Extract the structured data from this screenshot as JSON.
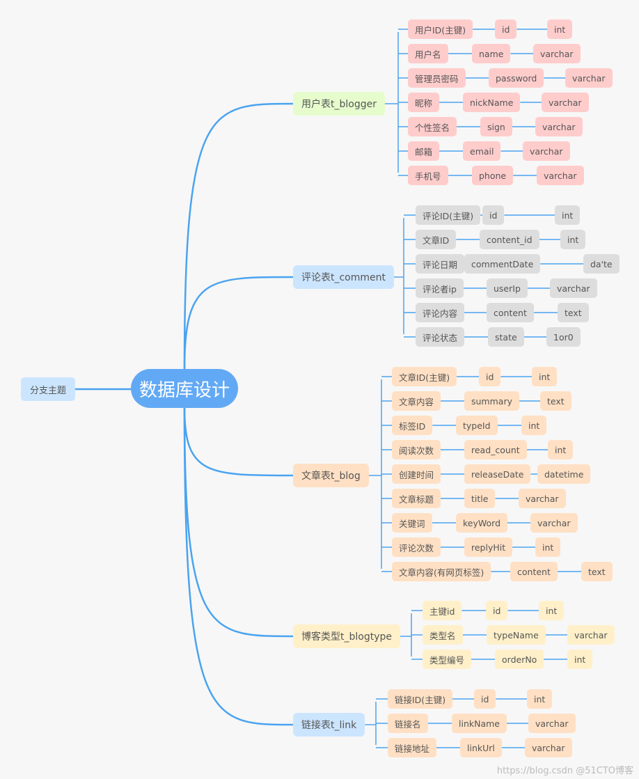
{
  "root": {
    "label": "数据库设计",
    "color": "#62a9f5"
  },
  "floating_topic": {
    "label": "分支主题"
  },
  "line_color": "#4aa3f0",
  "tables": [
    {
      "name": "用户表t_blogger",
      "table_color": "#e6fccd",
      "field_color": "#ffcccc",
      "fields": [
        [
          "用户ID(主键)",
          "id",
          "int"
        ],
        [
          "用户名",
          "name",
          "varchar"
        ],
        [
          "管理员密码",
          "password",
          "varchar"
        ],
        [
          "昵称",
          "nickName",
          "varchar"
        ],
        [
          "个性签名",
          "sign",
          "varchar"
        ],
        [
          "邮箱",
          "email",
          "varchar"
        ],
        [
          "手机号",
          "phone",
          "varchar"
        ]
      ]
    },
    {
      "name": "评论表t_comment",
      "table_color": "#cce5ff",
      "field_color": "#dddddd",
      "fields": [
        [
          "评论ID(主键)",
          "id",
          "int"
        ],
        [
          "文章ID",
          "content_id",
          "int"
        ],
        [
          "评论日期",
          "commentDate",
          "da'te"
        ],
        [
          "评论者ip",
          "userIp",
          "varchar"
        ],
        [
          "评论内容",
          "content",
          "text"
        ],
        [
          "评论状态",
          "state",
          "1or0"
        ]
      ]
    },
    {
      "name": "文章表t_blog",
      "table_color": "#ffe0c4",
      "field_color": "#ffe0c4",
      "fields": [
        [
          "文章ID(主键)",
          "id",
          "int"
        ],
        [
          "文章内容",
          "summary",
          "text"
        ],
        [
          "标签ID",
          "typeId",
          "int"
        ],
        [
          "阅读次数",
          "read_count",
          "int"
        ],
        [
          "创建时间",
          "releaseDate",
          "datetime"
        ],
        [
          "文章标题",
          "title",
          "varchar"
        ],
        [
          "关键词",
          "keyWord",
          "varchar"
        ],
        [
          "评论次数",
          "replyHit",
          "int"
        ],
        [
          "文章内容(有网页标签)",
          "content",
          "text"
        ]
      ]
    },
    {
      "name": "博客类型t_blogtype",
      "table_color": "#fff0c9",
      "field_color": "#fff0c9",
      "fields": [
        [
          "主键id",
          "id",
          "int"
        ],
        [
          "类型名",
          "typeName",
          "varchar"
        ],
        [
          "类型编号",
          "orderNo",
          "int"
        ]
      ]
    },
    {
      "name": "链接表t_link",
      "table_color": "#cce5ff",
      "field_color": "#ffe0c4",
      "fields": [
        [
          "链接ID(主键)",
          "id",
          "int"
        ],
        [
          "链接名",
          "linkName",
          "varchar"
        ],
        [
          "链接地址",
          "linkUrl",
          "varchar"
        ]
      ]
    }
  ],
  "watermark": "https://blog.csdn @51CTO博客"
}
